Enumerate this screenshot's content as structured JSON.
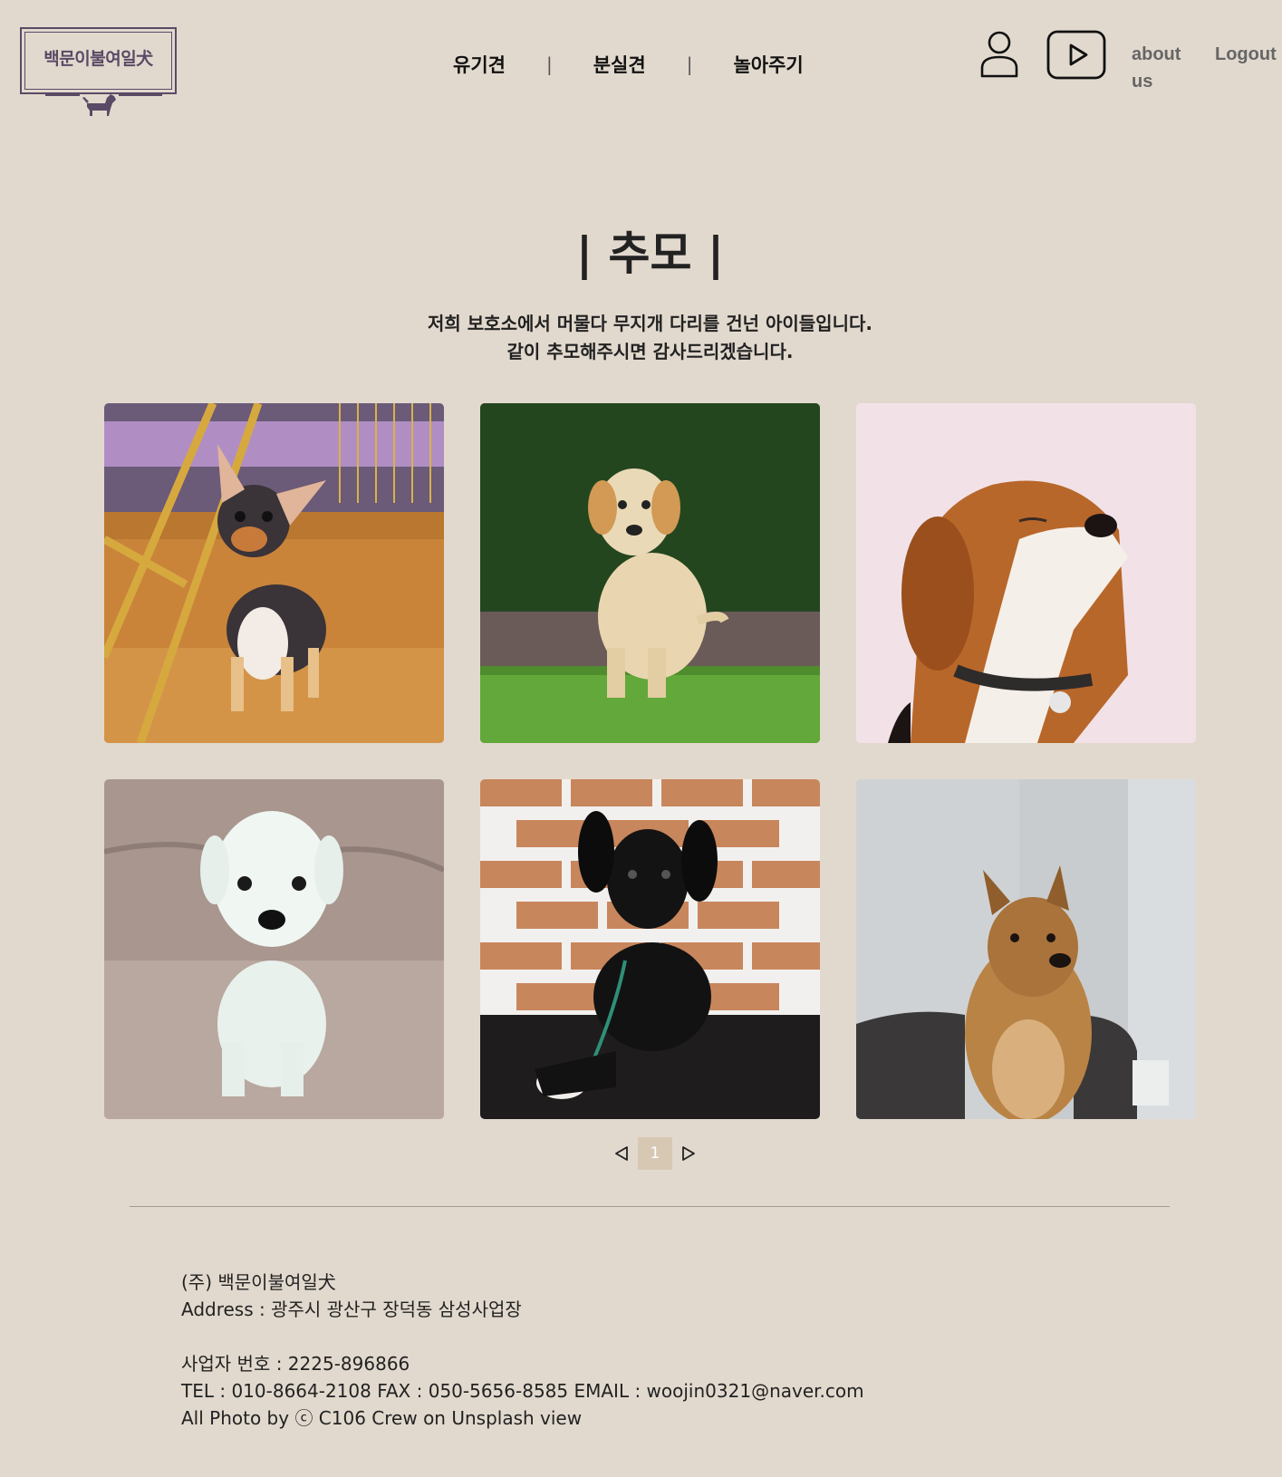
{
  "header": {
    "logo_text": "백문이불여일犬",
    "nav": [
      {
        "label": "유기견"
      },
      {
        "label": "분실견"
      },
      {
        "label": "놀아주기"
      }
    ],
    "nav_separator": "|",
    "icons": [
      "user-icon",
      "youtube-play-icon"
    ],
    "about_label": "about us",
    "logout_label": "Logout"
  },
  "main": {
    "title": "| 추모 |",
    "intro_line1": "저희 보호소에서 머물다 무지개 다리를 건넌 아이들입니다.",
    "intro_line2": "같이 추모해주시면 감사드리겠습니다.",
    "photos": [
      {
        "subject": "chihuahua"
      },
      {
        "subject": "golden-retriever-puppy"
      },
      {
        "subject": "beagle"
      },
      {
        "subject": "white-puppy"
      },
      {
        "subject": "black-puppy"
      },
      {
        "subject": "pomeranian"
      }
    ]
  },
  "pagination": {
    "prev_icon": "triangle-left-icon",
    "current_page": "1",
    "next_icon": "triangle-right-icon"
  },
  "footer": {
    "company": "(주) 백문이불여일犬",
    "address": "Address : 광주시 광산구 장덕동 삼성사업장",
    "business_no": "사업자 번호 : 2225-896866",
    "contact": "TEL : 010-8664-2108 FAX : 050-5656-8585 EMAIL : woojin0321@naver.com",
    "credit": "All Photo by ⓒ C106 Crew on Unsplash view"
  },
  "colors": {
    "background": "#e2d9ce",
    "logo": "#5a4a66",
    "pager_active": "#d7c8b4"
  }
}
